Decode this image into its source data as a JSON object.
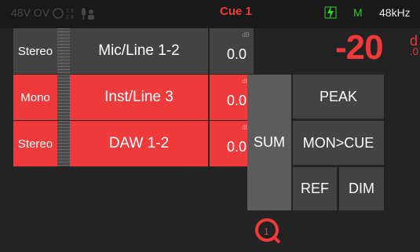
{
  "status_bar": {
    "phantom": "48V OV",
    "cue_label": "Cue 1",
    "mode_indicator": "M",
    "sample_rate": "48kHz",
    "colors": {
      "active_red": "#f03a38",
      "ok_green": "#2cd12c"
    }
  },
  "channels": [
    {
      "mode": "Stereo",
      "name": "Mic/Line 1-2",
      "gain_unit": "dB",
      "gain_value": "0.0",
      "selected": false
    },
    {
      "mode": "Mono",
      "name": "Inst/Line 3",
      "gain_unit": "dB",
      "gain_value": "0.0",
      "selected": true
    },
    {
      "mode": "Stereo",
      "name": "DAW 1-2",
      "gain_unit": "dB",
      "gain_value": "0.0",
      "selected": true
    }
  ],
  "monitor": {
    "level": "-20",
    "level_unit": "d",
    "level_decimal": ".0",
    "buttons": {
      "sum": "SUM",
      "peak": "PEAK",
      "mon_cue": "MON>CUE",
      "ref": "REF",
      "dim": "DIM"
    },
    "cue_badge": "1"
  }
}
